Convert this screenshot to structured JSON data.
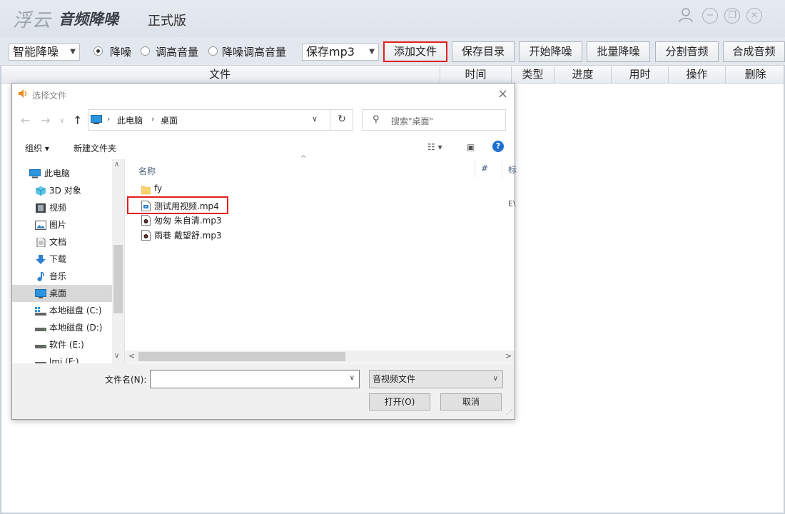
{
  "app": {
    "brand": "浮云",
    "product": "音频降噪",
    "edition": "正式版"
  },
  "toolbar": {
    "mode_select": "智能降噪",
    "radio_options": [
      {
        "label": "降噪",
        "checked": true
      },
      {
        "label": "调高音量",
        "checked": false
      },
      {
        "label": "降噪调高音量",
        "checked": false
      }
    ],
    "format_select": "保存mp3",
    "buttons": [
      "添加文件",
      "保存目录",
      "开始降噪",
      "批量降噪",
      "分割音频",
      "合成音频"
    ]
  },
  "table": {
    "columns": [
      "文件",
      "时间",
      "类型",
      "进度",
      "用时",
      "操作",
      "删除"
    ]
  },
  "dialog": {
    "title": "选择文件",
    "address": {
      "segments": [
        "此电脑",
        "桌面"
      ]
    },
    "search_placeholder": "搜索\"桌面\"",
    "commands": {
      "organize": "组织 ▾",
      "new_folder": "新建文件夹"
    },
    "tree": [
      {
        "label": "此电脑",
        "icon": "pc-icon"
      },
      {
        "label": "3D 对象",
        "icon": "3d-objects-icon"
      },
      {
        "label": "视频",
        "icon": "video-icon"
      },
      {
        "label": "图片",
        "icon": "pictures-icon"
      },
      {
        "label": "文档",
        "icon": "documents-icon"
      },
      {
        "label": "下载",
        "icon": "download-icon"
      },
      {
        "label": "音乐",
        "icon": "music-icon"
      },
      {
        "label": "桌面",
        "icon": "desktop-icon",
        "selected": true
      },
      {
        "label": "本地磁盘 (C:)",
        "icon": "drive-c-icon"
      },
      {
        "label": "本地磁盘 (D:)",
        "icon": "drive-icon"
      },
      {
        "label": "软件 (E:)",
        "icon": "drive-icon"
      },
      {
        "label": "lmj (F:)",
        "icon": "drive-icon"
      }
    ],
    "columns": {
      "name": "名称",
      "hash": "#",
      "tag": "标"
    },
    "files": [
      {
        "name": "fy",
        "icon": "folder-icon"
      },
      {
        "name": "测试用视频.mp4",
        "icon": "video-file-icon",
        "highlighted": true,
        "extra": "E\\"
      },
      {
        "name": "匆匆 朱自清.mp3",
        "icon": "audio-file-icon"
      },
      {
        "name": "雨巷 戴望舒.mp3",
        "icon": "audio-file-icon"
      }
    ],
    "filename_label": "文件名(N):",
    "filename_value": "",
    "filter": "音视频文件",
    "open_button": "打开(O)",
    "cancel_button": "取消"
  },
  "colors": {
    "highlight": "#e02020",
    "titlebar": "#e3e8ee",
    "accent_blue": "#1f6fcf"
  }
}
